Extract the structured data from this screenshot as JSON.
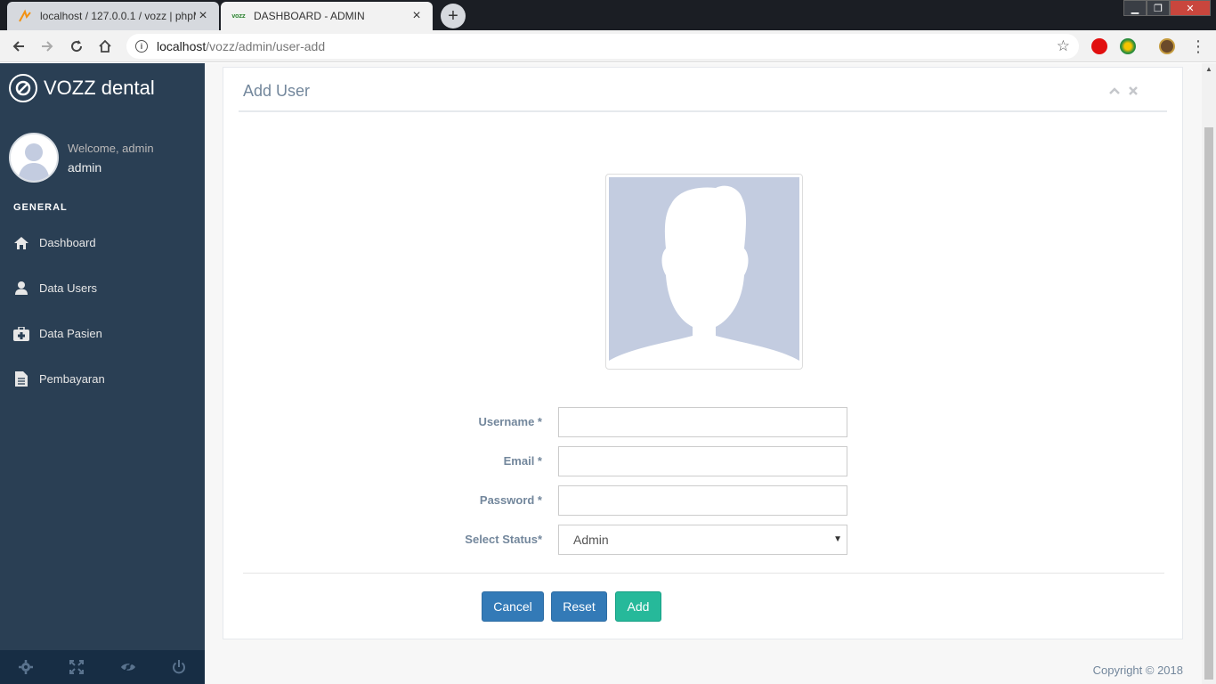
{
  "browser": {
    "tabs": [
      {
        "title": "localhost / 127.0.0.1 / vozz | phpMyAdmin",
        "favicon": "PMA"
      },
      {
        "title": "DASHBOARD - ADMIN",
        "favicon": "VOZZ"
      }
    ],
    "new_tab_label": "+",
    "url_host": "localhost",
    "url_path": "/vozz/admin/user-add"
  },
  "sidebar": {
    "brand": "VOZZ dental",
    "welcome": "Welcome, admin",
    "user_name": "admin",
    "section_title": "GENERAL",
    "items": [
      {
        "label": "Dashboard",
        "icon": "home-icon"
      },
      {
        "label": "Data Users",
        "icon": "user-icon"
      },
      {
        "label": "Data Pasien",
        "icon": "medkit-icon"
      },
      {
        "label": "Pembayaran",
        "icon": "file-icon"
      }
    ],
    "footer_icons": [
      "settings-icon",
      "fullscreen-icon",
      "lock-icon",
      "logout-icon"
    ]
  },
  "panel": {
    "title": "Add User",
    "form": {
      "username_label": "Username *",
      "username_value": "",
      "email_label": "Email *",
      "email_value": "",
      "password_label": "Password *",
      "password_value": "",
      "status_label": "Select Status*",
      "status_selected": "Admin"
    },
    "buttons": {
      "cancel": "Cancel",
      "reset": "Reset",
      "add": "Add"
    }
  },
  "footer": {
    "copyright": "Copyright © 2018"
  },
  "colors": {
    "sidebar_bg": "#2a3f54",
    "primary": "#337ab7",
    "success": "#26b99a",
    "text_muted": "#73879c"
  }
}
